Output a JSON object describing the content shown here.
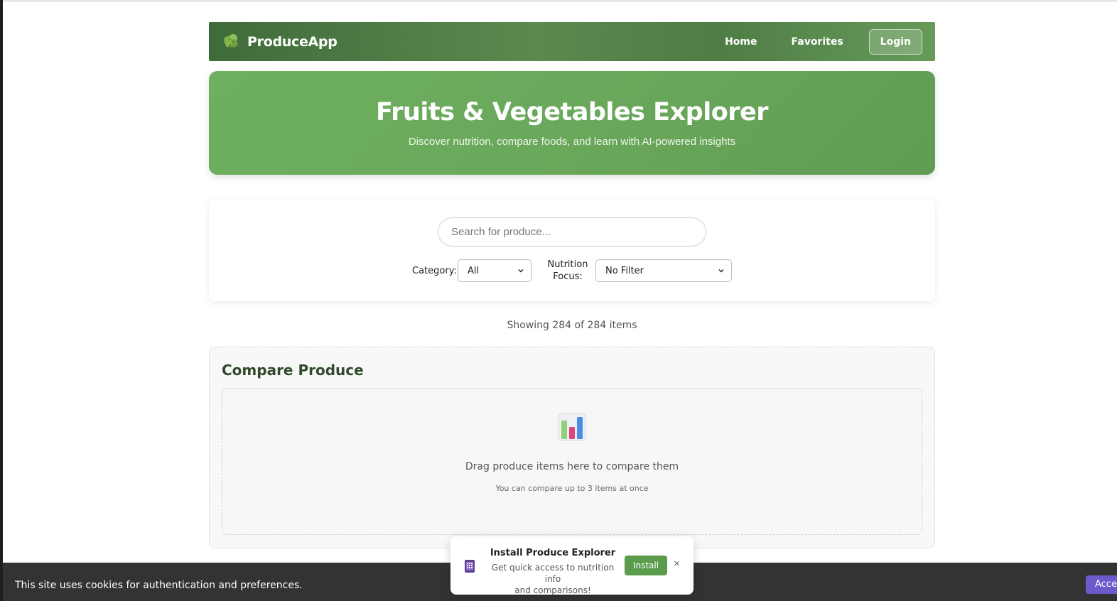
{
  "navbar": {
    "brand": "ProduceApp",
    "links": [
      "Home",
      "Favorites"
    ],
    "login_label": "Login",
    "logo_icon": "broccoli-icon"
  },
  "hero": {
    "title": "Fruits & Vegetables Explorer",
    "subtitle": "Discover nutrition, compare foods, and learn with AI-powered insights"
  },
  "search": {
    "placeholder": "Search for produce...",
    "category_label": "Category:",
    "category_value": "All",
    "nutrition_label_line1": "Nutrition",
    "nutrition_label_line2": "Focus:",
    "nutrition_value": "No Filter"
  },
  "results": {
    "showing_text": "Showing 284 of 284 items"
  },
  "compare": {
    "title": "Compare Produce",
    "icon": "bar-chart-icon",
    "drop_text": "Drag produce items here to compare them",
    "drop_note": "You can compare up to 3 items at once"
  },
  "cookie": {
    "text": "This site uses cookies for authentication and preferences.",
    "accept_label": "Accept"
  },
  "install": {
    "icon": "phone-icon",
    "title": "Install Produce Explorer",
    "desc_line1": "Get quick access to nutrition info",
    "desc_line2": "and comparisons!",
    "button_label": "Install",
    "close_label": "×"
  },
  "colors": {
    "nav_green": "#4e7d45",
    "hero_green": "#6aa85b",
    "title_green": "#2f4a2a",
    "install_green": "#5a9c4c",
    "cookie_bg": "#333333",
    "accept_purple": "#6a5acd"
  }
}
